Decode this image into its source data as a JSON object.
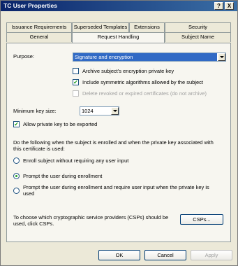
{
  "window": {
    "title": "TC User Properties",
    "help_label": "?",
    "close_label": "X"
  },
  "tabs_row1": [
    "Issuance Requirements",
    "Superseded Templates",
    "Extensions",
    "Security"
  ],
  "tabs_row2": [
    "General",
    "Request Handling",
    "Subject Name"
  ],
  "active_tab": "Request Handling",
  "purpose": {
    "label": "Purpose:",
    "value": "Signature and encryption"
  },
  "options": {
    "archive": {
      "label": "Archive subject's encryption private key",
      "checked": false
    },
    "symmetric": {
      "label": "Include symmetric algorithms allowed by the subject",
      "checked": true
    },
    "delete_revoked": {
      "label": "Delete revoked or expired certificates (do not archive)",
      "checked": false,
      "enabled": false
    }
  },
  "min_key": {
    "label": "Minimum key size:",
    "value": "1024"
  },
  "allow_export": {
    "label": "Allow private key to be exported",
    "checked": true
  },
  "enroll_instructions": "Do the following when the subject is enrolled and when the private key associated with this certificate is used:",
  "radios": [
    {
      "label": "Enroll subject without requiring any user input",
      "selected": false
    },
    {
      "label": "Prompt the user during enrollment",
      "selected": true
    },
    {
      "label": "Prompt the user during enrollment and require user input when the private key is used",
      "selected": false
    }
  ],
  "csp_text": "To choose which cryptographic service providers (CSPs) should be used, click CSPs.",
  "csp_button": "CSPs...",
  "footer": {
    "ok": "OK",
    "cancel": "Cancel",
    "apply": "Apply"
  },
  "icons": {
    "check": "checkmark-icon",
    "dropdown": "chevron-down-icon"
  },
  "colors": {
    "titlebar": "#0a246a",
    "selection": "#316ac5",
    "check": "#21a121"
  }
}
